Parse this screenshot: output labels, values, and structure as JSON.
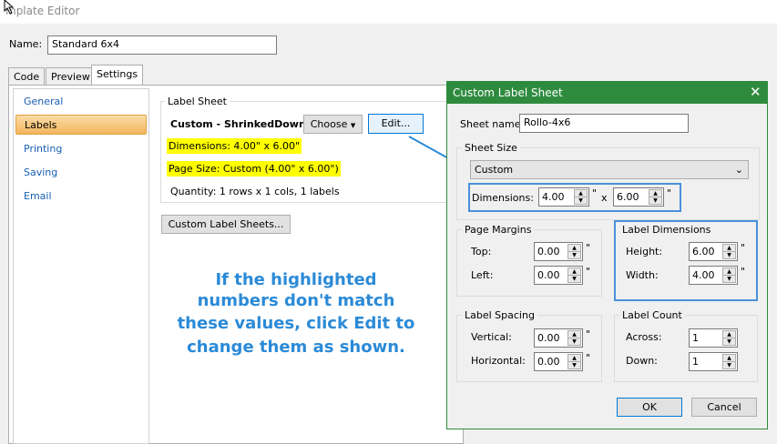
{
  "app": {
    "title": "mplate Editor"
  },
  "name_field": {
    "label": "Name:",
    "value": "Standard 6x4"
  },
  "tabs": [
    "Code",
    "Preview",
    "Settings"
  ],
  "nav": [
    "General",
    "Labels",
    "Printing",
    "Saving",
    "Email"
  ],
  "label_sheet": {
    "group_label": "Label Sheet",
    "sheet_name": "Custom - ShrinkedDown",
    "choose_label": "Choose",
    "edit_label": "Edit...",
    "dimensions": "Dimensions:  4.00\"  x  6.00\"",
    "page_size": "Page Size:    Custom (4.00\"  x  6.00\")",
    "quantity": "Quantity:      1 rows  x  1 cols,  1 labels",
    "custom_button": "Custom Label Sheets..."
  },
  "callout": [
    "If the highlighted",
    "numbers don't match",
    "these values, click Edit to",
    "change them as shown."
  ],
  "dialog": {
    "title": "Custom Label Sheet",
    "sheet_name_label": "Sheet name:",
    "sheet_name_value": "Rollo-4x6",
    "sheet_size_label": "Sheet Size",
    "sheet_size_value": "Custom",
    "dimensions_label": "Dimensions:",
    "dim_w": "4.00",
    "dim_h": "6.00",
    "x_sep": "x",
    "inch": "\"",
    "page_margins": {
      "label": "Page Margins",
      "top_label": "Top:",
      "top": "0.00",
      "left_label": "Left:",
      "left": "0.00"
    },
    "label_dimensions": {
      "label": "Label Dimensions",
      "height_label": "Height:",
      "height": "6.00",
      "width_label": "Width:",
      "width": "4.00"
    },
    "label_spacing": {
      "label": "Label Spacing",
      "vertical_label": "Vertical:",
      "vertical": "0.00",
      "horizontal_label": "Horizontal:",
      "horizontal": "0.00"
    },
    "label_count": {
      "label": "Label Count",
      "across_label": "Across:",
      "across": "1",
      "down_label": "Down:",
      "down": "1"
    },
    "ok_label": "OK",
    "cancel_label": "Cancel"
  },
  "colors": {
    "dialog_title": "#2e8b3e",
    "callout": "#2b8ad7",
    "highlight": "#ffff00",
    "selection": "#f3b55f",
    "annotation_border": "#4a90d9"
  }
}
